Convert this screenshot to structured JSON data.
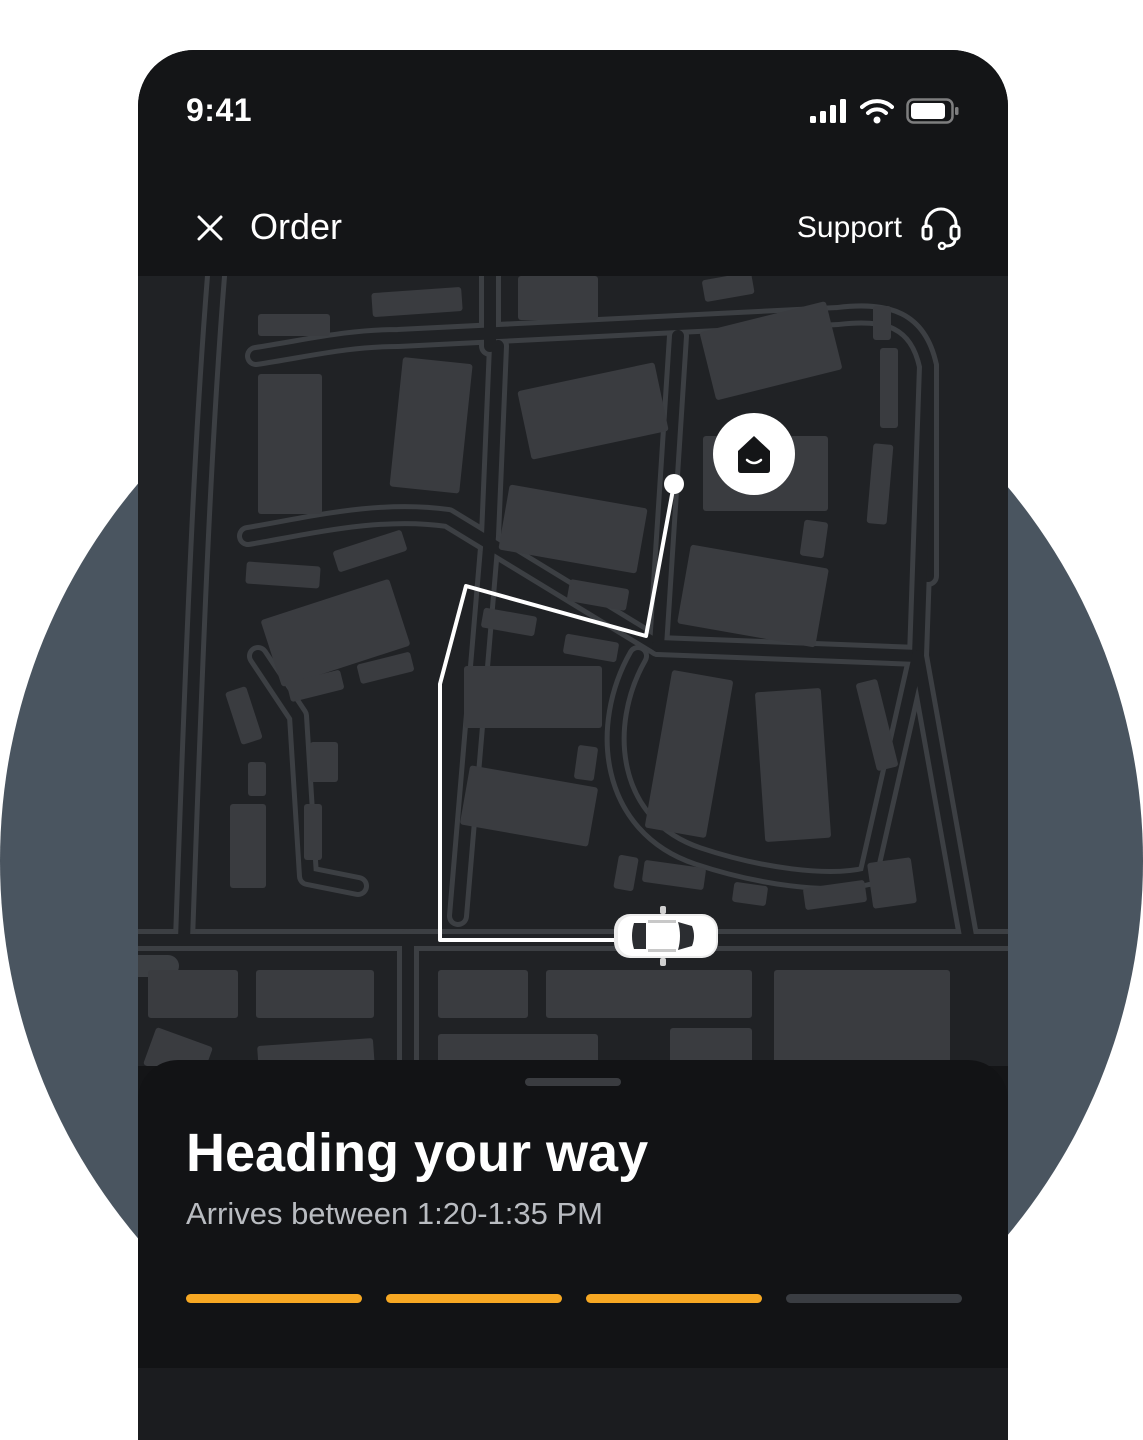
{
  "status_bar": {
    "time": "9:41",
    "icons": [
      "cellular-signal-icon",
      "wifi-icon",
      "battery-icon"
    ]
  },
  "header": {
    "close_icon": "close-icon",
    "title": "Order",
    "support_label": "Support",
    "support_icon": "headset-icon"
  },
  "map": {
    "destination_icon": "home-icon",
    "vehicle_icon": "car-icon"
  },
  "sheet": {
    "title": "Heading your way",
    "subtitle": "Arrives between 1:20-1:35 PM",
    "progress": {
      "total_steps": 4,
      "completed_steps": 3,
      "active_color": "#f7a823",
      "inactive_color": "#3a3d42"
    }
  },
  "colors": {
    "background_circle": "#4a5560",
    "phone_bg": "#141517",
    "map_bg": "#202225",
    "map_block": "#3a3c40",
    "route": "#ffffff"
  }
}
